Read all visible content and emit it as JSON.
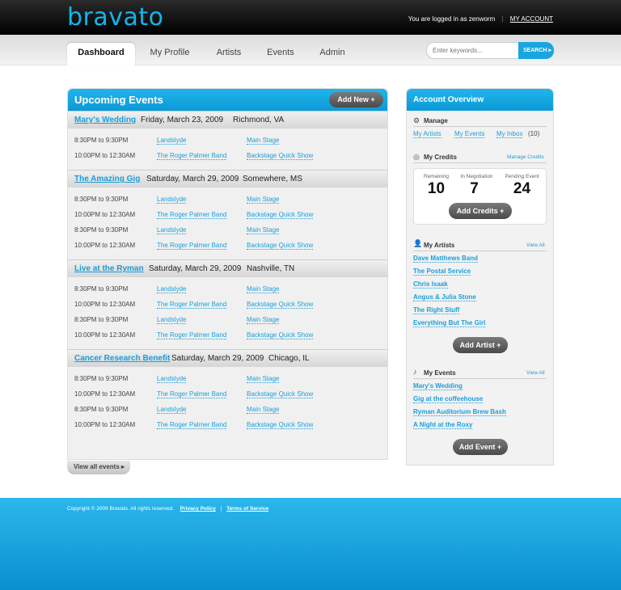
{
  "header": {
    "logo": "bravato",
    "logged_in": "You are logged in as zenworm",
    "separator": "|",
    "my_account": "MY ACCOUNT"
  },
  "nav": {
    "tabs": [
      "Dashboard",
      "My Profile",
      "Artists",
      "Events",
      "Admin"
    ],
    "search_placeholder": "Enter keywords...",
    "search_button": "SEARCH"
  },
  "upcoming": {
    "title": "Upcoming Events",
    "add_new": "Add New +",
    "view_all": "View all events",
    "events": [
      {
        "name": "Mary's Wedding",
        "date": "Friday, March 23, 2009",
        "location": "Richmond, VA",
        "slots": [
          {
            "time": "8:30PM to 9:30PM",
            "band": "Landslyde",
            "stage": "Main Stage"
          },
          {
            "time": "10:00PM to 12:30AM",
            "band": "The Roger Palmer Band",
            "stage": "Backstage Quick Show"
          }
        ]
      },
      {
        "name": "The Amazing Gig",
        "date": "Saturday, March 29, 2009",
        "location": "Somewhere, MS",
        "slots": [
          {
            "time": "8:30PM to 9:30PM",
            "band": "Landslyde",
            "stage": "Main Stage"
          },
          {
            "time": "10:00PM to 12:30AM",
            "band": "The Roger Palmer Band",
            "stage": "Backstage Quick Show"
          },
          {
            "time": "8:30PM to 9:30PM",
            "band": "Landslyde",
            "stage": "Main Stage"
          },
          {
            "time": "10:00PM to 12:30AM",
            "band": "The Roger Palmer Band",
            "stage": "Backstage Quick Show"
          }
        ]
      },
      {
        "name": "Live at the Ryman",
        "date": "Saturday, March 29, 2009",
        "location": "Nashville, TN",
        "slots": [
          {
            "time": "8:30PM to 9:30PM",
            "band": "Landslyde",
            "stage": "Main Stage"
          },
          {
            "time": "10:00PM to 12:30AM",
            "band": "The Roger Palmer Band",
            "stage": "Backstage Quick Show"
          },
          {
            "time": "8:30PM to 9:30PM",
            "band": "Landslyde",
            "stage": "Main Stage"
          },
          {
            "time": "10:00PM to 12:30AM",
            "band": "The Roger Palmer Band",
            "stage": "Backstage Quick Show"
          }
        ]
      },
      {
        "name": "Cancer Research Benefit",
        "date": "Saturday, March 29, 2009",
        "location": "Chicago, IL",
        "slots": [
          {
            "time": "8:30PM to 9:30PM",
            "band": "Landslyde",
            "stage": "Main Stage"
          },
          {
            "time": "10:00PM to 12:30AM",
            "band": "The Roger Palmer Band",
            "stage": "Backstage Quick Show"
          },
          {
            "time": "8:30PM to 9:30PM",
            "band": "Landslyde",
            "stage": "Main Stage"
          },
          {
            "time": "10:00PM to 12:30AM",
            "band": "The Roger Palmer Band",
            "stage": "Backstage Quick Show"
          }
        ]
      }
    ]
  },
  "account": {
    "title": "Account Overview",
    "manage": {
      "title": "Manage",
      "links": [
        "My Artists",
        "My Events",
        "My Inbox"
      ],
      "inbox_count": "(10)"
    },
    "credits": {
      "title": "My Credits",
      "manage_link": "Manage Credits",
      "labels": [
        "Remaining",
        "In Negotiation",
        "Pending Event"
      ],
      "values": [
        "10",
        "7",
        "24"
      ],
      "add_button": "Add Credits +"
    },
    "artists": {
      "title": "My Artists",
      "view_all": "View All",
      "items": [
        "Dave Matthews Band",
        "The Postal Service",
        "Chris Isaak",
        "Angus & Julia Stone",
        "The Right Stuff",
        "Everything But The Girl"
      ],
      "add_button": "Add Artist +"
    },
    "events": {
      "title": "My Events",
      "view_all": "View All",
      "items": [
        "Mary's Wedding",
        "Gig at the coffeehouse",
        "Ryman Auditorium Brew Bash",
        "A Night at the Roxy"
      ],
      "add_button": "Add Event +"
    }
  },
  "footer": {
    "copyright": "Copyright © 2009 Bravato. All rights reserved.",
    "privacy": "Privacy Policy",
    "separator": "|",
    "terms": "Terms of Service"
  },
  "colors": {
    "accent": "#1a9ed9",
    "header_bg": "#000000",
    "footer_bg": "#19a6df"
  },
  "icons": [
    "gear-icon",
    "coins-icon",
    "person-icon",
    "music-note-icon",
    "arrow-right-icon"
  ]
}
